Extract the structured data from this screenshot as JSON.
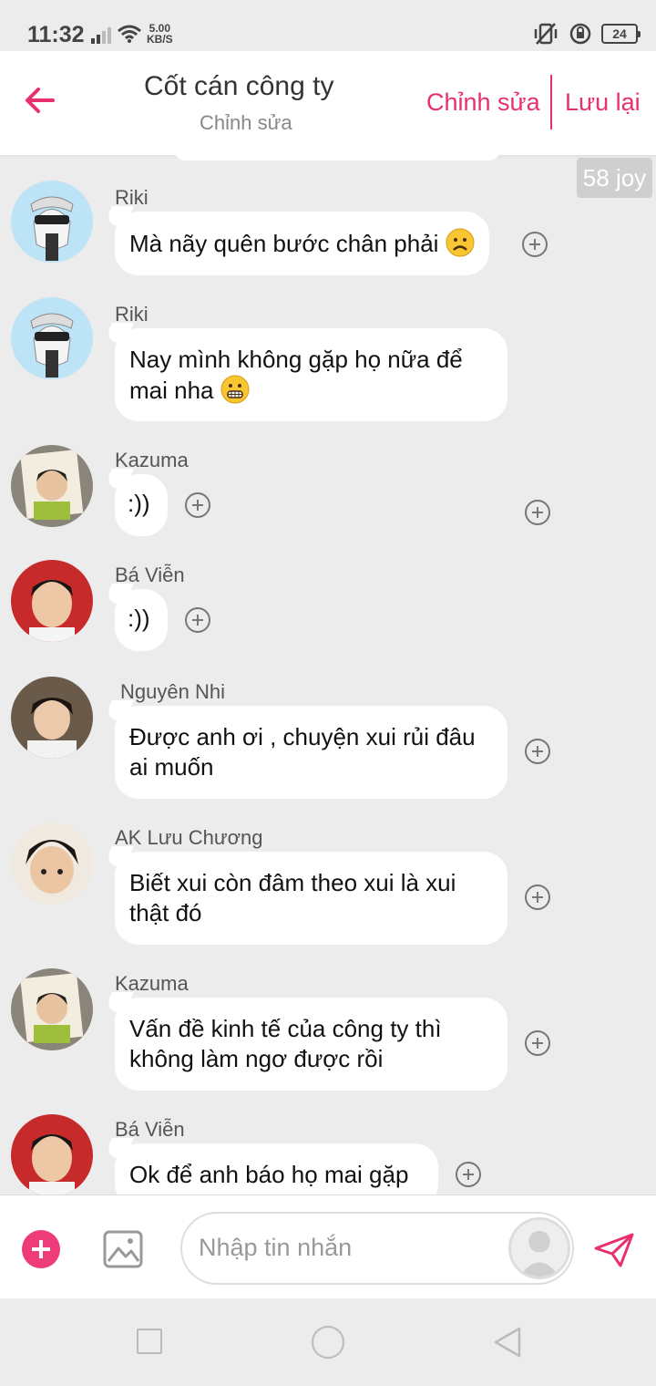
{
  "status_bar": {
    "time": "11:32",
    "net_speed_value": "5.00",
    "net_speed_unit": "KB/S",
    "battery": "24"
  },
  "header": {
    "title": "Cốt cán công ty",
    "subtitle": "Chỉnh sửa",
    "edit_label": "Chỉnh sửa",
    "save_label": "Lưu lại",
    "accent_color": "#e8306e"
  },
  "joy_badge": "58 joy",
  "messages": [
    {
      "sender": "Riki",
      "text": "Mà nãy quên bước chân phải",
      "emoji": "frowning-face"
    },
    {
      "sender": "Riki",
      "text_lines": [
        "Nay mình không gặp họ nữa để",
        "mai nha"
      ],
      "emoji": "grimacing-face"
    },
    {
      "sender": "Kazuma",
      "text": ":))"
    },
    {
      "sender": "Bá Viễn",
      "text": ":))"
    },
    {
      "sender": "Nguyên Nhi",
      "text_lines": [
        "Được anh ơi , chuyện xui rủi đâu",
        "ai muốn"
      ]
    },
    {
      "sender": "AK Lưu Chương",
      "text_lines": [
        "Biết xui còn đâm theo xui là xui",
        "thật đó"
      ]
    },
    {
      "sender": "Kazuma",
      "text_lines": [
        "Vấn đề kinh tế của công ty thì",
        "không làm ngơ được rồi"
      ]
    },
    {
      "sender": "Bá Viễn",
      "text": "Ok để anh báo họ mai gặp"
    }
  ],
  "composer": {
    "placeholder": "Nhập tin nhắn",
    "add_icon": "plus-circle-icon",
    "image_icon": "image-icon",
    "send_icon": "send-icon"
  },
  "nav_bar": {
    "icons": [
      "recent-apps-icon",
      "home-icon",
      "back-triangle-icon"
    ]
  }
}
